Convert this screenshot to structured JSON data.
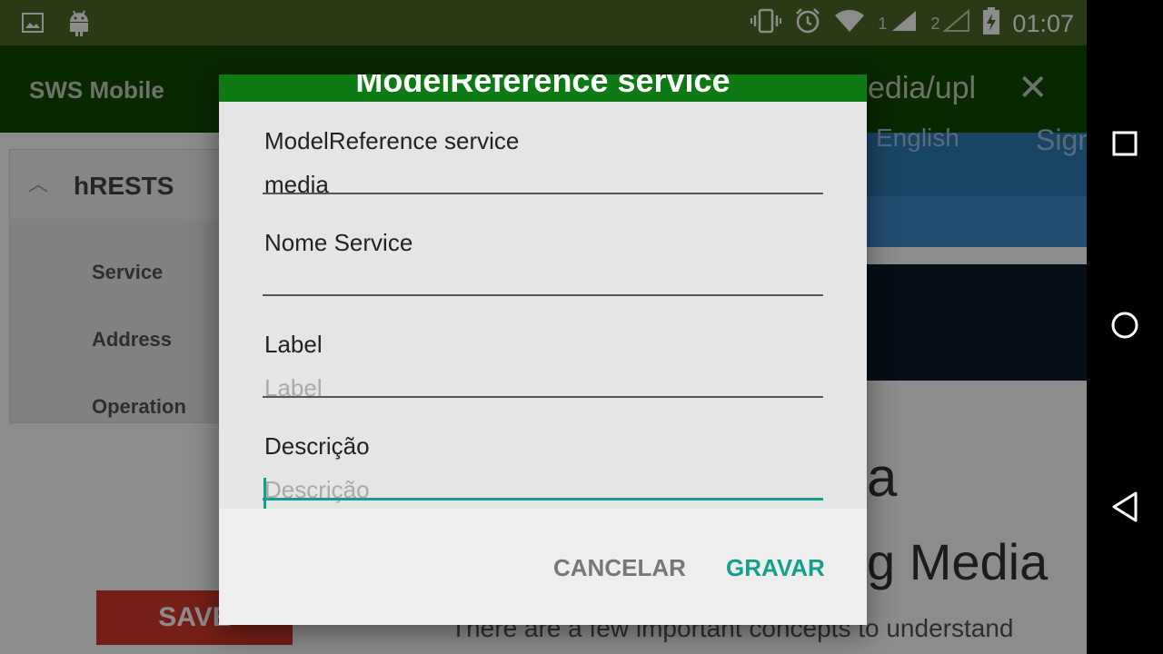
{
  "statusbar": {
    "sim1_label": "1",
    "sim2_label": "2",
    "time": "01:07"
  },
  "appbar": {
    "title": "SWS Mobile",
    "url": "edia/upl"
  },
  "background_page": {
    "sidebar_heading": "hRESTS",
    "sidebar_items": [
      "Service",
      "Address",
      "Operation"
    ],
    "save_button": "SAVE",
    "language": "English",
    "sign": "Sign",
    "heading_fragment": "a",
    "heading_line2": "g Media",
    "body_text": "There are a few important concepts to understand"
  },
  "dialog": {
    "title": "ModelReference service",
    "fields": [
      {
        "label": "ModelReference service",
        "value": "media",
        "placeholder": ""
      },
      {
        "label": "Nome Service",
        "value": "",
        "placeholder": ""
      },
      {
        "label": "Label",
        "value": "",
        "placeholder": "Label"
      },
      {
        "label": "Descrição",
        "value": "",
        "placeholder": "Descrição"
      }
    ],
    "cancel_label": "CANCELAR",
    "save_label": "GRAVAR"
  },
  "colors": {
    "statusbar": "#4d6a27",
    "appbar": "#0f4a00",
    "dialog_title_bar": "#0e7a14",
    "accent": "#149e8e"
  }
}
